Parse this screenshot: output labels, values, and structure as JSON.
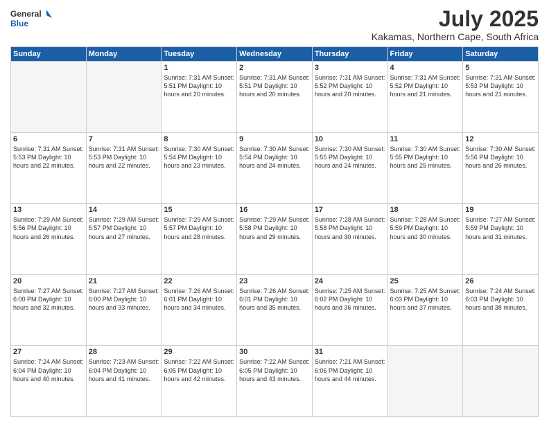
{
  "header": {
    "logo_line1": "General",
    "logo_line2": "Blue",
    "title": "July 2025",
    "subtitle": "Kakamas, Northern Cape, South Africa"
  },
  "weekdays": [
    "Sunday",
    "Monday",
    "Tuesday",
    "Wednesday",
    "Thursday",
    "Friday",
    "Saturday"
  ],
  "weeks": [
    [
      {
        "day": "",
        "info": ""
      },
      {
        "day": "",
        "info": ""
      },
      {
        "day": "1",
        "info": "Sunrise: 7:31 AM\nSunset: 5:51 PM\nDaylight: 10 hours and 20 minutes."
      },
      {
        "day": "2",
        "info": "Sunrise: 7:31 AM\nSunset: 5:51 PM\nDaylight: 10 hours and 20 minutes."
      },
      {
        "day": "3",
        "info": "Sunrise: 7:31 AM\nSunset: 5:52 PM\nDaylight: 10 hours and 20 minutes."
      },
      {
        "day": "4",
        "info": "Sunrise: 7:31 AM\nSunset: 5:52 PM\nDaylight: 10 hours and 21 minutes."
      },
      {
        "day": "5",
        "info": "Sunrise: 7:31 AM\nSunset: 5:53 PM\nDaylight: 10 hours and 21 minutes."
      }
    ],
    [
      {
        "day": "6",
        "info": "Sunrise: 7:31 AM\nSunset: 5:53 PM\nDaylight: 10 hours and 22 minutes."
      },
      {
        "day": "7",
        "info": "Sunrise: 7:31 AM\nSunset: 5:53 PM\nDaylight: 10 hours and 22 minutes."
      },
      {
        "day": "8",
        "info": "Sunrise: 7:30 AM\nSunset: 5:54 PM\nDaylight: 10 hours and 23 minutes."
      },
      {
        "day": "9",
        "info": "Sunrise: 7:30 AM\nSunset: 5:54 PM\nDaylight: 10 hours and 24 minutes."
      },
      {
        "day": "10",
        "info": "Sunrise: 7:30 AM\nSunset: 5:55 PM\nDaylight: 10 hours and 24 minutes."
      },
      {
        "day": "11",
        "info": "Sunrise: 7:30 AM\nSunset: 5:55 PM\nDaylight: 10 hours and 25 minutes."
      },
      {
        "day": "12",
        "info": "Sunrise: 7:30 AM\nSunset: 5:56 PM\nDaylight: 10 hours and 26 minutes."
      }
    ],
    [
      {
        "day": "13",
        "info": "Sunrise: 7:29 AM\nSunset: 5:56 PM\nDaylight: 10 hours and 26 minutes."
      },
      {
        "day": "14",
        "info": "Sunrise: 7:29 AM\nSunset: 5:57 PM\nDaylight: 10 hours and 27 minutes."
      },
      {
        "day": "15",
        "info": "Sunrise: 7:29 AM\nSunset: 5:57 PM\nDaylight: 10 hours and 28 minutes."
      },
      {
        "day": "16",
        "info": "Sunrise: 7:29 AM\nSunset: 5:58 PM\nDaylight: 10 hours and 29 minutes."
      },
      {
        "day": "17",
        "info": "Sunrise: 7:28 AM\nSunset: 5:58 PM\nDaylight: 10 hours and 30 minutes."
      },
      {
        "day": "18",
        "info": "Sunrise: 7:28 AM\nSunset: 5:59 PM\nDaylight: 10 hours and 30 minutes."
      },
      {
        "day": "19",
        "info": "Sunrise: 7:27 AM\nSunset: 5:59 PM\nDaylight: 10 hours and 31 minutes."
      }
    ],
    [
      {
        "day": "20",
        "info": "Sunrise: 7:27 AM\nSunset: 6:00 PM\nDaylight: 10 hours and 32 minutes."
      },
      {
        "day": "21",
        "info": "Sunrise: 7:27 AM\nSunset: 6:00 PM\nDaylight: 10 hours and 33 minutes."
      },
      {
        "day": "22",
        "info": "Sunrise: 7:26 AM\nSunset: 6:01 PM\nDaylight: 10 hours and 34 minutes."
      },
      {
        "day": "23",
        "info": "Sunrise: 7:26 AM\nSunset: 6:01 PM\nDaylight: 10 hours and 35 minutes."
      },
      {
        "day": "24",
        "info": "Sunrise: 7:25 AM\nSunset: 6:02 PM\nDaylight: 10 hours and 36 minutes."
      },
      {
        "day": "25",
        "info": "Sunrise: 7:25 AM\nSunset: 6:03 PM\nDaylight: 10 hours and 37 minutes."
      },
      {
        "day": "26",
        "info": "Sunrise: 7:24 AM\nSunset: 6:03 PM\nDaylight: 10 hours and 38 minutes."
      }
    ],
    [
      {
        "day": "27",
        "info": "Sunrise: 7:24 AM\nSunset: 6:04 PM\nDaylight: 10 hours and 40 minutes."
      },
      {
        "day": "28",
        "info": "Sunrise: 7:23 AM\nSunset: 6:04 PM\nDaylight: 10 hours and 41 minutes."
      },
      {
        "day": "29",
        "info": "Sunrise: 7:22 AM\nSunset: 6:05 PM\nDaylight: 10 hours and 42 minutes."
      },
      {
        "day": "30",
        "info": "Sunrise: 7:22 AM\nSunset: 6:05 PM\nDaylight: 10 hours and 43 minutes."
      },
      {
        "day": "31",
        "info": "Sunrise: 7:21 AM\nSunset: 6:06 PM\nDaylight: 10 hours and 44 minutes."
      },
      {
        "day": "",
        "info": ""
      },
      {
        "day": "",
        "info": ""
      }
    ]
  ]
}
